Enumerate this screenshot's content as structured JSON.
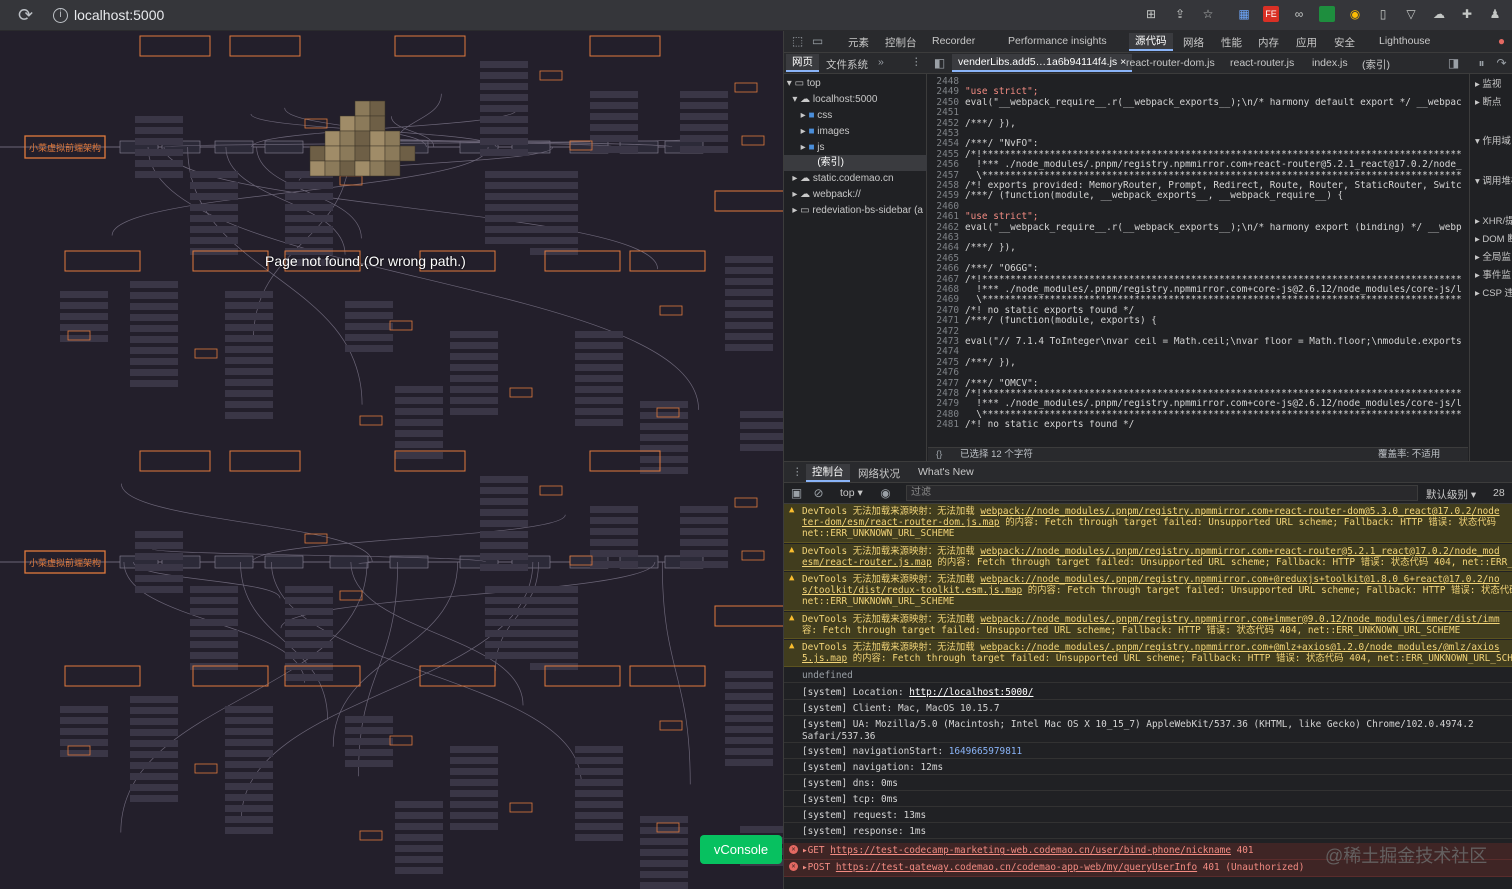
{
  "browser": {
    "url": "localhost:5000"
  },
  "page": {
    "error_text": "Page not found.(Or wrong path.)",
    "vconsole_label": "vConsole",
    "mindmap_root_label": "小菜虚拟前端架构"
  },
  "devtools": {
    "tabs": [
      "元素",
      "控制台",
      "Recorder",
      "Performance insights",
      "源代码",
      "网络",
      "性能",
      "内存",
      "应用",
      "安全",
      "Lighthouse"
    ],
    "active_tab": "源代码",
    "sources_subtabs": [
      "网页",
      "文件系统"
    ],
    "file_tabs": [
      "venderLibs.add5…1a6b94114f4.js",
      "react-router-dom.js",
      "react-router.js",
      "index.js",
      "(索引)"
    ],
    "tree": {
      "top": "top",
      "host": "localhost:5000",
      "folders": [
        "css",
        "images",
        "js"
      ],
      "selected": "(索引)",
      "others": [
        "static.codemao.cn",
        "webpack://",
        "redeviation-bs-sidebar (a"
      ]
    },
    "code_lines": [
      {
        "n": "2448",
        "t": ""
      },
      {
        "n": "2449",
        "t": "\"use strict\";"
      },
      {
        "n": "2450",
        "t": "eval(\"__webpack_require__.r(__webpack_exports__);\\n/* harmony default export */ __webpac"
      },
      {
        "n": "2451",
        "t": ""
      },
      {
        "n": "2452",
        "t": "/***/ }),"
      },
      {
        "n": "2453",
        "t": ""
      },
      {
        "n": "2454",
        "t": "/***/ \"NvFO\":"
      },
      {
        "n": "2455",
        "t": "/*!*************************************************************************************"
      },
      {
        "n": "2456",
        "t": "  !*** ./node_modules/.pnpm/registry.npmmirror.com+react-router@5.2.1_react@17.0.2/node_"
      },
      {
        "n": "2457",
        "t": "  \\*************************************************************************************"
      },
      {
        "n": "2458",
        "t": "/*! exports provided: MemoryRouter, Prompt, Redirect, Route, Router, StaticRouter, Switc"
      },
      {
        "n": "2459",
        "t": "/***/ (function(module, __webpack_exports__, __webpack_require__) {"
      },
      {
        "n": "2460",
        "t": ""
      },
      {
        "n": "2461",
        "t": "\"use strict\";"
      },
      {
        "n": "2462",
        "t": "eval(\"__webpack_require__.r(__webpack_exports__);\\n/* harmony export (binding) */ __webp"
      },
      {
        "n": "2463",
        "t": ""
      },
      {
        "n": "2464",
        "t": "/***/ }),"
      },
      {
        "n": "2465",
        "t": ""
      },
      {
        "n": "2466",
        "t": "/***/ \"O6GG\":"
      },
      {
        "n": "2467",
        "t": "/*!*************************************************************************************"
      },
      {
        "n": "2468",
        "t": "  !*** ./node_modules/.pnpm/registry.npmmirror.com+core-js@2.6.12/node_modules/core-js/l"
      },
      {
        "n": "2469",
        "t": "  \\*************************************************************************************"
      },
      {
        "n": "2470",
        "t": "/*! no static exports found */"
      },
      {
        "n": "2471",
        "t": "/***/ (function(module, exports) {"
      },
      {
        "n": "2472",
        "t": ""
      },
      {
        "n": "2473",
        "t": "eval(\"// 7.1.4 ToInteger\\nvar ceil = Math.ceil;\\nvar floor = Math.floor;\\nmodule.exports"
      },
      {
        "n": "2474",
        "t": ""
      },
      {
        "n": "2475",
        "t": "/***/ }),"
      },
      {
        "n": "2476",
        "t": ""
      },
      {
        "n": "2477",
        "t": "/***/ \"OMCV\":"
      },
      {
        "n": "2478",
        "t": "/*!*************************************************************************************"
      },
      {
        "n": "2479",
        "t": "  !*** ./node_modules/.pnpm/registry.npmmirror.com+core-js@2.6.12/node_modules/core-js/l"
      },
      {
        "n": "2480",
        "t": "  \\*************************************************************************************"
      },
      {
        "n": "2481",
        "t": "/*! no static exports found */"
      }
    ],
    "status_left": "已选择 12 个字符",
    "status_right": "覆盖率: 不适用",
    "side_panel": [
      "监视",
      "断点",
      "作用域",
      "调用堆栈",
      "XHR/提",
      "DOM 断",
      "全局监",
      "事件监",
      "CSP 违"
    ],
    "console_tabs": [
      "控制台",
      "网络状况",
      "What's New"
    ],
    "console_context": "top ▾",
    "filter_placeholder": "过滤",
    "level": "默认级别 ▾",
    "issue_count": "28",
    "warnings": [
      {
        "l1a": "DevTools 无法加载来源映射：无法加载 ",
        "l1b": "webpack://node_modules/.pnpm/registry.npmmirror.com+react-router-dom@5.3.0_react@17.0.2/node",
        "l2a": "ter-dom/esm/react-router-dom.js.map",
        "l2b": " 的内容: Fetch through target failed: Unsupported URL scheme; Fallback: HTTP 错误: 状态代码",
        "l3": "net::ERR_UNKNOWN_URL_SCHEME"
      },
      {
        "l1a": "DevTools 无法加载来源映射：无法加载 ",
        "l1b": "webpack://node_modules/.pnpm/registry.npmmirror.com+react-router@5.2.1_react@17.0.2/node_mod",
        "l2a": "esm/react-router.js.map",
        "l2b": " 的内容: Fetch through target failed: Unsupported URL scheme; Fallback: HTTP 错误: 状态代码 404, net::ERR_",
        "l3": ""
      },
      {
        "l1a": "DevTools 无法加载来源映射：无法加载 ",
        "l1b": "webpack://node_modules/.pnpm/registry.npmmirror.com+@reduxjs+toolkit@1.8.0_6+react@17.0.2/no",
        "l2a": "s/toolkit/dist/redux-toolkit.esm.js.map",
        "l2b": " 的内容: Fetch through target failed: Unsupported URL scheme; Fallback: HTTP 错误: 状态代码",
        "l3": "net::ERR_UNKNOWN_URL_SCHEME"
      },
      {
        "l1a": "DevTools 无法加载来源映射：无法加载 ",
        "l1b": "webpack://node_modules/.pnpm/registry.npmmirror.com+immer@9.0.12/node_modules/immer/dist/imm",
        "l2a": "",
        "l2b": "容: Fetch through target failed: Unsupported URL scheme; Fallback: HTTP 错误: 状态代码 404, net::ERR_UNKNOWN_URL_SCHEME",
        "l3": ""
      },
      {
        "l1a": "DevTools 无法加载来源映射：无法加载 ",
        "l1b": "webpack://node_modules/.pnpm/registry.npmmirror.com+@mlz+axios@1.2.0/node_modules/@mlz/axios",
        "l2a": "5.js.map",
        "l2b": " 的内容: Fetch through target failed: Unsupported URL scheme; Fallback: HTTP 错误: 状态代码 404, net::ERR_UNKNOWN_URL_SCH",
        "l3": ""
      }
    ],
    "undefined_line": "undefined",
    "system_lines": [
      {
        "a": "[system] Location: ",
        "b": "http://localhost:5000/"
      },
      {
        "a": "[system] Client: Mac, MacOS 10.15.7",
        "b": ""
      },
      {
        "a": "[system] UA: Mozilla/5.0 (Macintosh; Intel Mac OS X 10_15_7) AppleWebKit/537.36 (KHTML, like Gecko) Chrome/102.0.4974.2",
        "b": "",
        "c": "Safari/537.36"
      },
      {
        "a": "[system] navigationStart: ",
        "b": "1649665979811"
      },
      {
        "a": "[system] navigation: 12ms",
        "b": ""
      },
      {
        "a": "[system] dns: 0ms",
        "b": ""
      },
      {
        "a": "[system] tcp: 0ms",
        "b": ""
      },
      {
        "a": "[system] request: 13ms",
        "b": ""
      },
      {
        "a": "[system] response: 1ms",
        "b": ""
      }
    ],
    "errors": [
      {
        "m": "▸GET ",
        "u": "https://test-codecamp-marketing-web.codemao.cn/user/bind-phone/nickname",
        "s": " 401"
      },
      {
        "m": "▸POST ",
        "u": "https://test-gateway.codemao.cn/codemao-app-web/my/queryUserInfo",
        "s": " 401 (Unauthorized)"
      }
    ],
    "error_right": "vcon"
  },
  "watermark": "@稀土掘金技术社区",
  "colors": {
    "accent": "#8ab4f8",
    "mindmap": "#e07a3d",
    "warn": "#f2d478",
    "error": "#f28b82",
    "vconsole": "#07c160"
  }
}
